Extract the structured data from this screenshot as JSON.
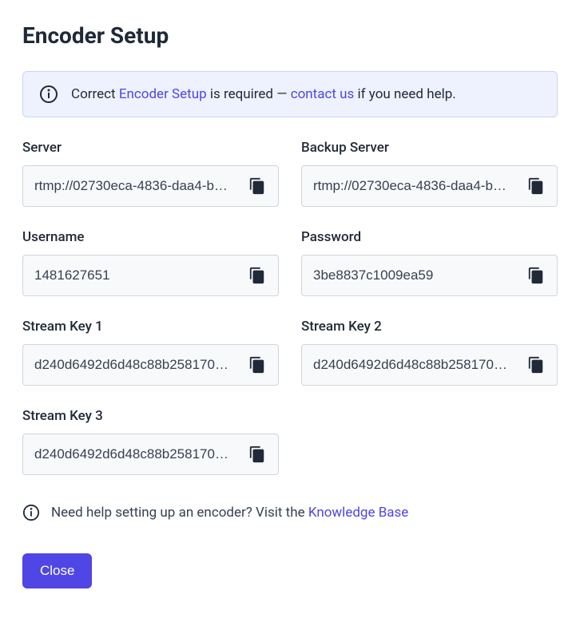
{
  "title": "Encoder Setup",
  "alert": {
    "before": "Correct ",
    "link1": "Encoder Setup",
    "middle": " is required — ",
    "link2": "contact us",
    "after": " if you need help."
  },
  "fields": {
    "server": {
      "label": "Server",
      "value": "rtmp://02730eca-4836-daa4-b…"
    },
    "backup_server": {
      "label": "Backup Server",
      "value": "rtmp://02730eca-4836-daa4-b…"
    },
    "username": {
      "label": "Username",
      "value": "1481627651"
    },
    "password": {
      "label": "Password",
      "value": "3be8837c1009ea59"
    },
    "stream_key_1": {
      "label": "Stream Key 1",
      "value": "d240d6492d6d48c88b258170…"
    },
    "stream_key_2": {
      "label": "Stream Key 2",
      "value": "d240d6492d6d48c88b258170…"
    },
    "stream_key_3": {
      "label": "Stream Key 3",
      "value": "d240d6492d6d48c88b258170…"
    }
  },
  "help": {
    "text": "Need help setting up an encoder? Visit the ",
    "link": "Knowledge Base"
  },
  "close_label": "Close"
}
